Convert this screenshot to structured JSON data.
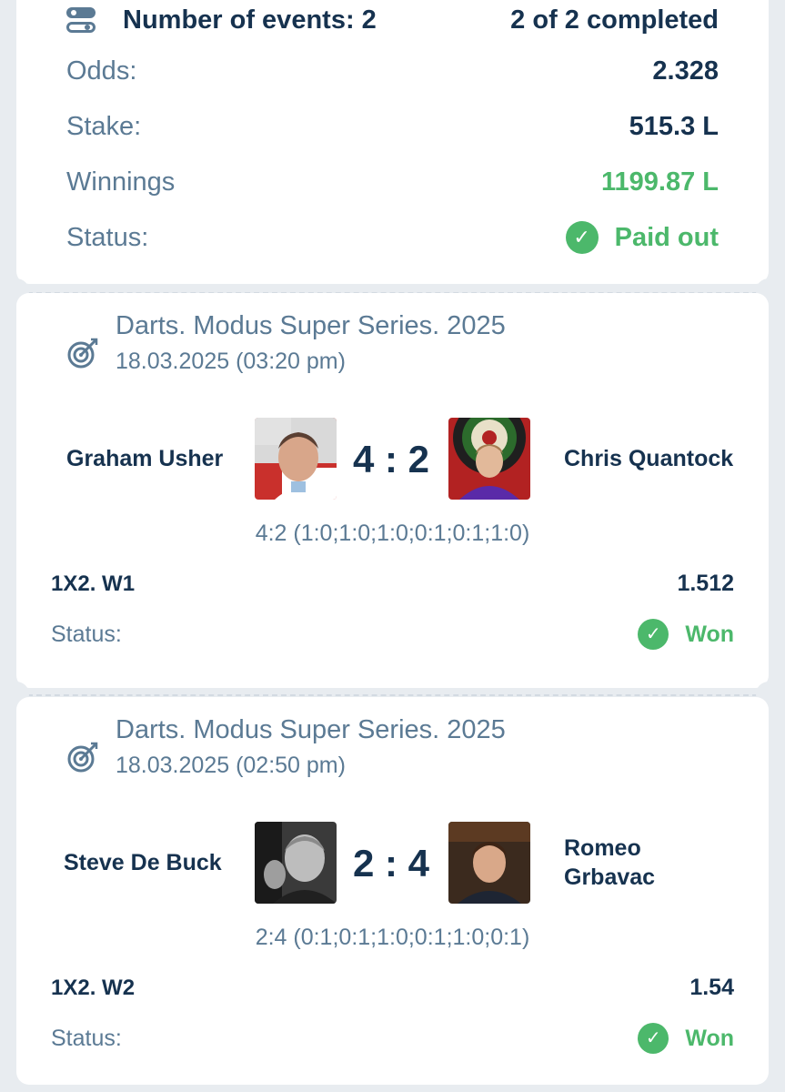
{
  "summary": {
    "events_label": "Number of events: 2",
    "completed": "2 of 2 completed",
    "odds_label": "Odds:",
    "odds_value": "2.328",
    "stake_label": "Stake:",
    "stake_value": "515.3 L",
    "winnings_label": "Winnings",
    "winnings_value": "1199.87 L",
    "status_label": "Status:",
    "status_value": "Paid out"
  },
  "events": [
    {
      "tournament": "Darts. Modus Super Series. 2025",
      "datetime": "18.03.2025 (03:20 pm)",
      "home": "Graham Usher",
      "away": "Chris Quantock",
      "score": "4 : 2",
      "sets": "4:2 (1:0;1:0;1:0;0:1;0:1;1:0)",
      "bet": "1X2. W1",
      "odds": "1.512",
      "status_label": "Status:",
      "status_value": "Won"
    },
    {
      "tournament": "Darts. Modus Super Series. 2025",
      "datetime": "18.03.2025 (02:50 pm)",
      "home": "Steve De Buck",
      "away_line1": "Romeo",
      "away_line2": "Grbavac",
      "score": "2 : 4",
      "sets": "2:4 (0:1;0:1;1:0;0:1;1:0;0:1)",
      "bet": "1X2. W2",
      "odds": "1.54",
      "status_label": "Status:",
      "status_value": "Won"
    }
  ],
  "icons": {
    "summary_icon": "toggle-list-icon",
    "event_icon": "dartboard-icon",
    "status_icon": "check-circle-icon"
  },
  "colors": {
    "primary_text": "#16324f",
    "secondary_text": "#5b7a94",
    "success": "#4cb86b",
    "background": "#e8ecf0"
  }
}
